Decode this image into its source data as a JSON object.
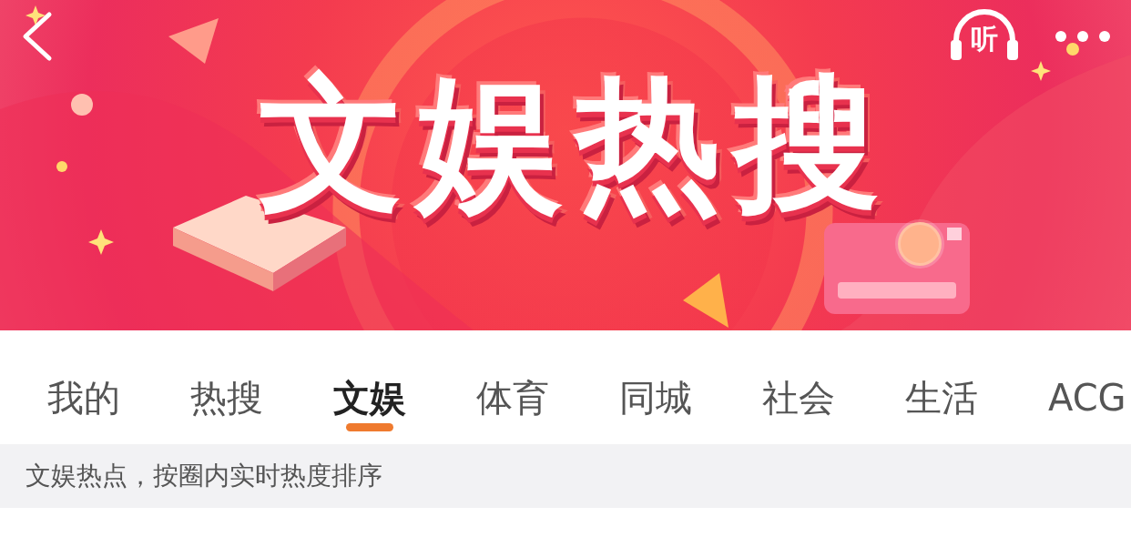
{
  "banner": {
    "title": "文娱热搜",
    "listen_label": "听"
  },
  "tabs": [
    {
      "label": "我的",
      "selected": false
    },
    {
      "label": "热搜",
      "selected": false
    },
    {
      "label": "文娱",
      "selected": true
    },
    {
      "label": "体育",
      "selected": false
    },
    {
      "label": "同城",
      "selected": false
    },
    {
      "label": "社会",
      "selected": false
    },
    {
      "label": "生活",
      "selected": false
    },
    {
      "label": "ACG",
      "selected": false
    }
  ],
  "hint": "文娱热点，按圈内实时热度排序"
}
